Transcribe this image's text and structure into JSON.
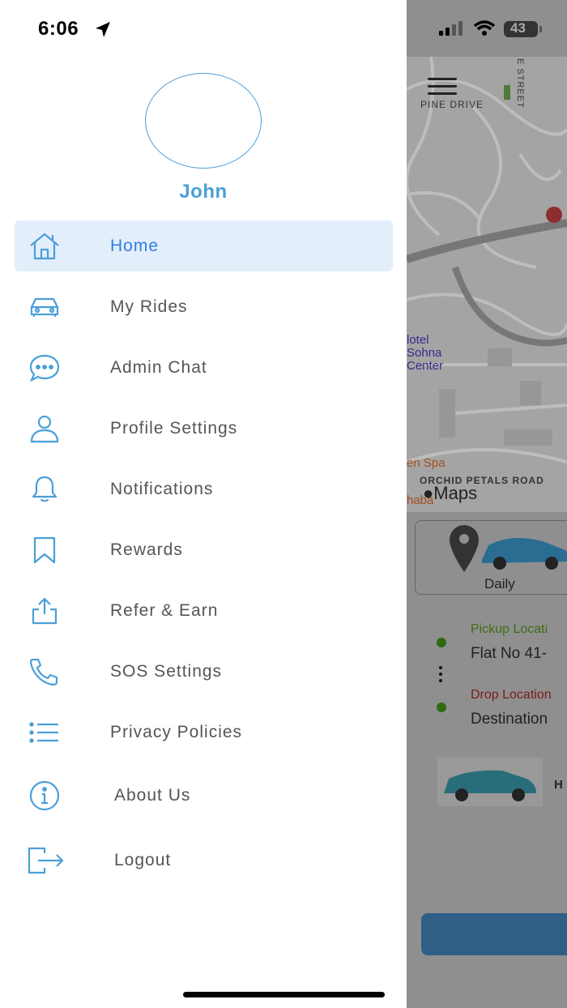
{
  "status_bar": {
    "time": "6:06",
    "battery": "43"
  },
  "drawer": {
    "user_name": "John",
    "menu": [
      {
        "label": "Home",
        "icon": "home-icon",
        "active": true
      },
      {
        "label": "My Rides",
        "icon": "car-icon"
      },
      {
        "label": "Admin Chat",
        "icon": "chat-bubble-icon"
      },
      {
        "label": "Profile Settings",
        "icon": "user-icon"
      },
      {
        "label": "Notifications",
        "icon": "bell-icon"
      },
      {
        "label": "Rewards",
        "icon": "bookmark-icon"
      },
      {
        "label": "Refer & Earn",
        "icon": "share-icon"
      },
      {
        "label": "SOS Settings",
        "icon": "phone-icon"
      },
      {
        "label": "Privacy Policies",
        "icon": "list-icon"
      },
      {
        "label": "About Us",
        "icon": "info-icon"
      },
      {
        "label": "Logout",
        "icon": "logout-icon"
      }
    ]
  },
  "background_app": {
    "map_labels": {
      "pine_drive": "PINE DRIVE",
      "e_street": "E STREET",
      "orchid_petals_road": "ORCHID PETALS ROAD",
      "hotel_line1": "lotel",
      "hotel_line2": "Sohna",
      "hotel_line3": "Center",
      "spa": "en Spa",
      "naba": "haba",
      "maps": "Maps"
    },
    "ride_type": "Daily",
    "pickup_label": "Pickup Locati",
    "pickup_value": "Flat No 41-",
    "drop_label": "Drop Location",
    "drop_value": "Destination",
    "car_label_cut": "H"
  },
  "colors": {
    "accent": "#4a9fd8",
    "active_text": "#2d7fe0",
    "active_bg": "#e3eefb",
    "pickup": "#4f8a1e",
    "drop": "#b42a2a"
  }
}
